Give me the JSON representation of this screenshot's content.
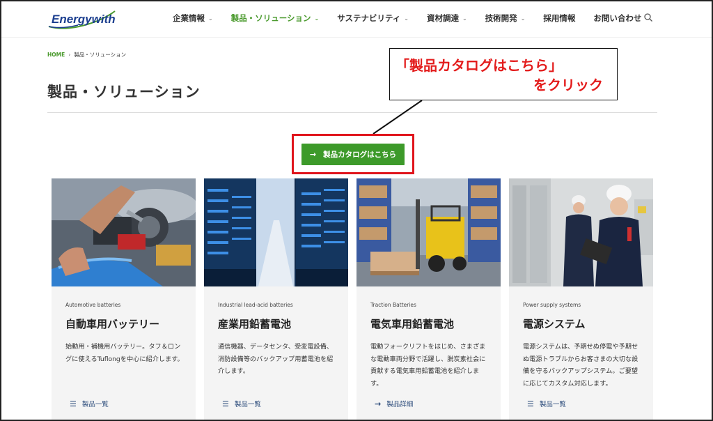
{
  "header": {
    "logo_text": "Energywith",
    "nav": [
      {
        "label": "企業情報",
        "has_dropdown": true,
        "active": false
      },
      {
        "label": "製品・ソリューション",
        "has_dropdown": true,
        "active": true
      },
      {
        "label": "サステナビリティ",
        "has_dropdown": true,
        "active": false
      },
      {
        "label": "資材調達",
        "has_dropdown": true,
        "active": false
      },
      {
        "label": "技術開発",
        "has_dropdown": true,
        "active": false
      },
      {
        "label": "採用情報",
        "has_dropdown": false,
        "active": false
      },
      {
        "label": "お問い合わせ",
        "has_dropdown": false,
        "active": false
      }
    ],
    "search_icon": "search-icon"
  },
  "breadcrumb": {
    "home": "HOME",
    "separator": "›",
    "current": "製品・ソリューション"
  },
  "page_title": "製品・ソリューション",
  "annotation": {
    "line1": "「製品カタログはこちら」",
    "line2": "をクリック",
    "color": "#e31c1c"
  },
  "catalog_button": {
    "label": "製品カタログはこちら",
    "icon": "arrow-right-icon",
    "color": "#3d9a2a"
  },
  "cards": [
    {
      "category": "Automotive batteries",
      "title": "自動車用バッテリー",
      "description": "始動用・補機用バッテリー。タフ＆ロングに使えるTuflongを中心に紹介します。",
      "link_label": "製品一覧",
      "link_icon": "list-icon"
    },
    {
      "category": "Industrial lead-acid batteries",
      "title": "産業用鉛蓄電池",
      "description": "通信機器、データセンタ、受変電設備、消防設備等のバックアップ用蓄電池を紹介します。",
      "link_label": "製品一覧",
      "link_icon": "list-icon"
    },
    {
      "category": "Traction Batteries",
      "title": "電気車用鉛蓄電池",
      "description": "電動フォークリフトをはじめ、さまざまな電動車両分野で活躍し、脱炭素社会に貢献する電気車用鉛蓄電池を紹介します。",
      "link_label": "製品詳細",
      "link_icon": "arrow-right-icon"
    },
    {
      "category": "Power supply systems",
      "title": "電源システム",
      "description": "電源システムは、予期せぬ停電や予期せぬ電源トラブルからお客さまの大切な設備を守るバックアップシステム。ご要望に応じてカスタム対応します。",
      "link_label": "製品一覧",
      "link_icon": "list-icon"
    }
  ]
}
